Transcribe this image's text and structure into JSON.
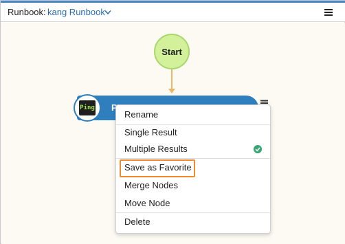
{
  "header": {
    "runbook_label": "Runbook:",
    "runbook_name": "kang Runbook"
  },
  "canvas": {
    "start_node_label": "Start",
    "action_node": {
      "title": "P",
      "badge_text": "Ping"
    }
  },
  "context_menu": {
    "rename": "Rename",
    "single_result": "Single Result",
    "multiple_results": "Multiple Results",
    "save_as_favorite": "Save as Favorite",
    "merge_nodes": "Merge Nodes",
    "move_node": "Move Node",
    "delete": "Delete",
    "selected_option": "Multiple Results"
  },
  "colors": {
    "accent_blue": "#2f7fbe",
    "start_node_green": "#d3f19a",
    "connector": "#e8b867",
    "highlight_orange": "#f08a2e",
    "check_green": "#3aa876"
  }
}
